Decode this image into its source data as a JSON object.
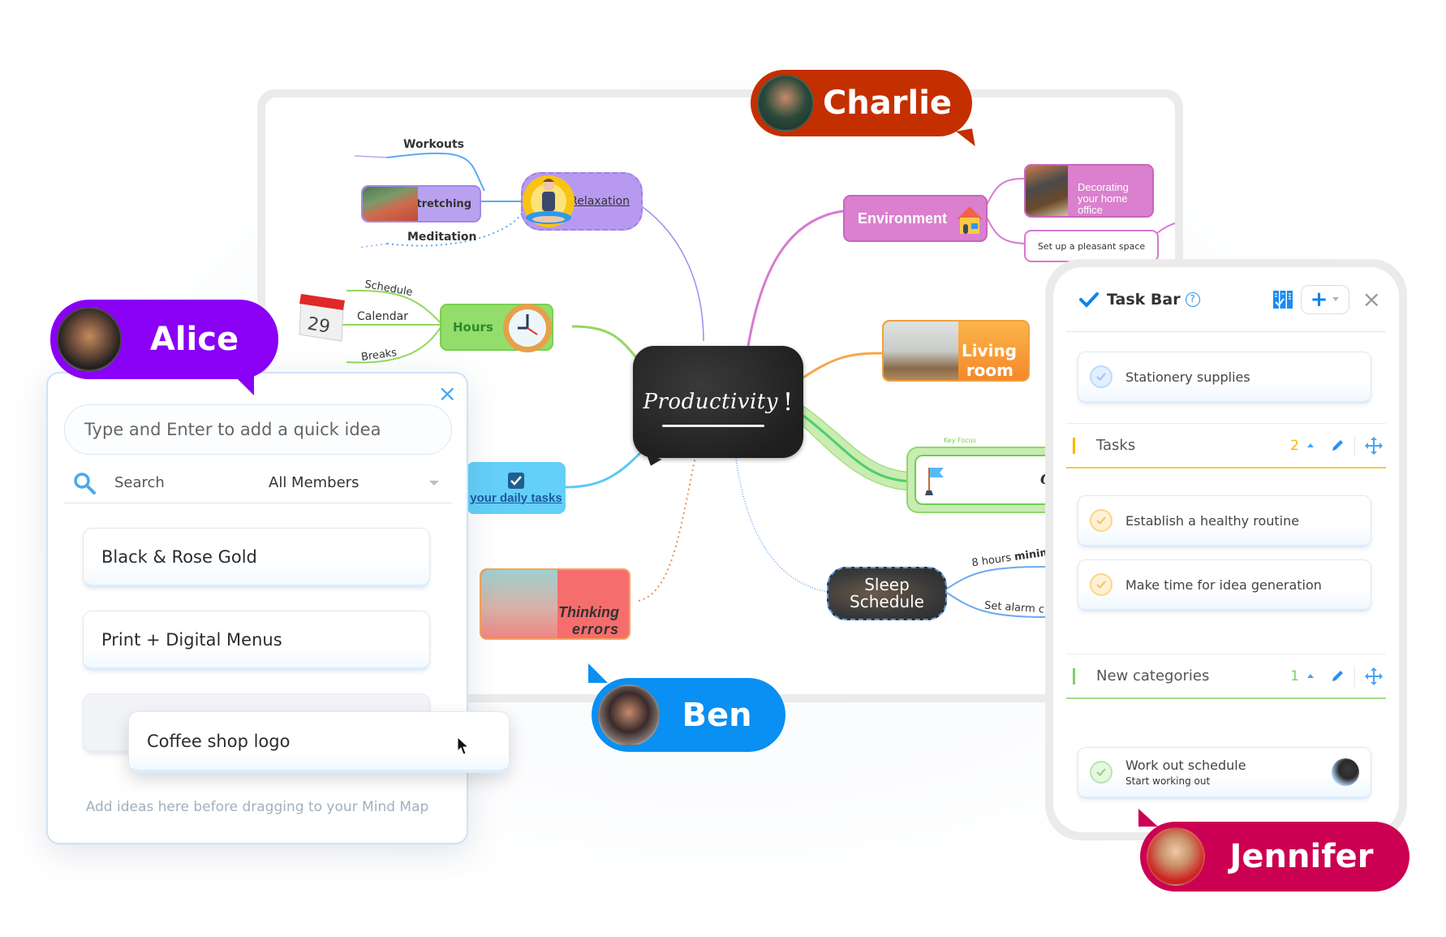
{
  "mindmap": {
    "central": {
      "title": "Productivity",
      "exclaim": "!"
    },
    "relaxation": {
      "label": "Relaxation",
      "children": [
        "Workouts",
        "Stretching",
        "Meditation"
      ]
    },
    "hours": {
      "label": "Hours",
      "children": [
        "Schedule",
        "Calendar",
        "Breaks"
      ],
      "calendar_day": "29"
    },
    "daily_tasks": {
      "label": "your daily tasks"
    },
    "thinking_errors": {
      "label_line1": "Thinking",
      "label_line2": "errors"
    },
    "environment": {
      "label": "Environment",
      "children": [
        {
          "label_line1": "Decorating",
          "label_line2": "your home",
          "label_line3": "office"
        },
        {
          "label": "Set up a pleasant space"
        }
      ]
    },
    "living_room": {
      "label_line1": "Living",
      "label_line2": "room"
    },
    "goals": {
      "label": "Goals",
      "tag": "Key Focus"
    },
    "sleep": {
      "label_line1": "Sleep",
      "label_line2": "Schedule",
      "children": [
        {
          "normal": "8 hours ",
          "bold": "minimum"
        },
        {
          "normal": "Set alarm clock",
          "bold": ""
        }
      ]
    }
  },
  "collaborators": [
    {
      "name": "Charlie",
      "color": "#c42f00"
    },
    {
      "name": "Alice",
      "color": "#8a00f5"
    },
    {
      "name": "Ben",
      "color": "#0a8ff2"
    },
    {
      "name": "Jennifer",
      "color": "#cc0052"
    }
  ],
  "ideas_panel": {
    "input_placeholder": "Type and Enter to add a quick idea",
    "search_label": "Search",
    "members_filter": "All Members",
    "ideas": [
      "Black & Rose Gold",
      "Print + Digital Menus"
    ],
    "dragging_idea": "Coffee shop logo",
    "hint": "Add ideas here before dragging to your Mind Map",
    "close_icon": "×"
  },
  "taskbar": {
    "title": "Task Bar",
    "help_icon": "?",
    "add_icon": "+",
    "close_icon": "×",
    "uncategorized_tasks": [
      {
        "text": "Stationery supplies",
        "status_color": "#8cbcf0"
      }
    ],
    "categories": [
      {
        "name": "Tasks",
        "count": "2",
        "color": "#f5b800",
        "tasks": [
          {
            "text": "Establish a healthy routine"
          },
          {
            "text": "Make time for idea generation"
          }
        ]
      },
      {
        "name": "New categories",
        "count": "1",
        "color": "#7ed06a",
        "tasks": [
          {
            "text": "Work out schedule",
            "subtext": "Start working out"
          }
        ]
      }
    ]
  }
}
